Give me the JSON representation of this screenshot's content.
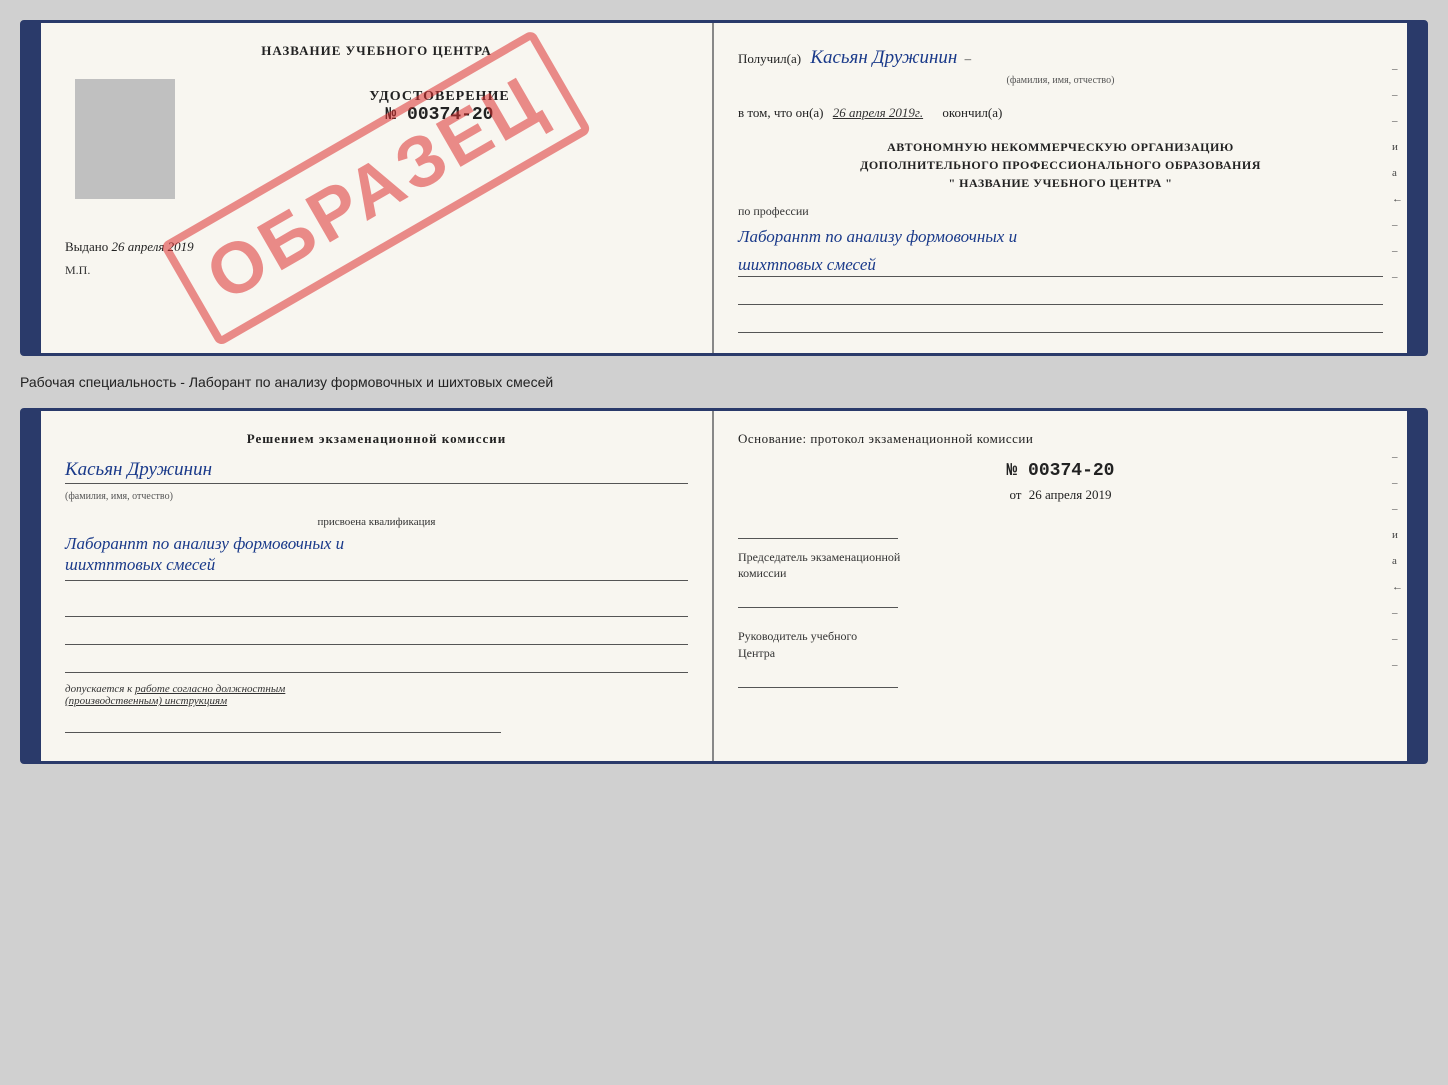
{
  "page": {
    "background_color": "#d0d0d0"
  },
  "top_book": {
    "left_page": {
      "title": "НАЗВАНИЕ УЧЕБНОГО ЦЕНТРА",
      "cert_label": "УДОСТОВЕРЕНИЕ",
      "cert_number": "№ 00374-20",
      "issued_prefix": "Выдано",
      "issued_date": "26 апреля 2019",
      "mp_label": "М.П.",
      "stamp_text": "ОБРАЗЕЦ"
    },
    "right_page": {
      "received_prefix": "Получил(а)",
      "received_name": "Касьян Дружинин",
      "fio_label": "(фамилия, имя, отчество)",
      "date_prefix": "в том, что он(а)",
      "date_value": "26 апреля 2019г.",
      "finished_suffix": "окончил(а)",
      "org_line1": "АВТОНОМНУЮ НЕКОММЕРЧЕСКУЮ ОРГАНИЗАЦИЮ",
      "org_line2": "ДОПОЛНИТЕЛЬНОГО ПРОФЕССИОНАЛЬНОГО ОБРАЗОВАНИЯ",
      "org_line3": "\"  НАЗВАНИЕ УЧЕБНОГО ЦЕНТРА  \"",
      "profession_label": "по профессии",
      "profession_name": "Лаборанпт по анализу формовочных и",
      "profession_name2": "шихтповых смесей",
      "side_marks": [
        "–",
        "–",
        "–",
        "и",
        "а",
        "←",
        "–",
        "–",
        "–"
      ]
    }
  },
  "specialty_text": "Рабочая специальность - Лаборант по анализу формовочных и шихтовых смесей",
  "bottom_book": {
    "left_page": {
      "decision_title": "Решением экзаменационной комиссии",
      "person_name": "Касьян Дружинин",
      "fio_label": "(фамилия, имя, отчество)",
      "qual_label": "присвоена квалификация",
      "qual_text": "Лаборанпт по анализу формовочных и",
      "qual_text2": "шихтптовых смесей",
      "allowed_prefix": "допускается к",
      "allowed_text": "работе согласно должностным",
      "allowed_text2": "(производственным) инструкциям"
    },
    "right_page": {
      "basis_title": "Основание: протокол экзаменационной комиссии",
      "protocol_number": "№ 00374-20",
      "date_prefix": "от",
      "date_value": "26 апреля 2019",
      "chairman_label": "Председатель экзаменационной",
      "chairman_label2": "комиссии",
      "head_label": "Руководитель учебного",
      "head_label2": "Центра",
      "side_marks": [
        "–",
        "–",
        "–",
        "и",
        "а",
        "←",
        "–",
        "–",
        "–"
      ]
    }
  }
}
